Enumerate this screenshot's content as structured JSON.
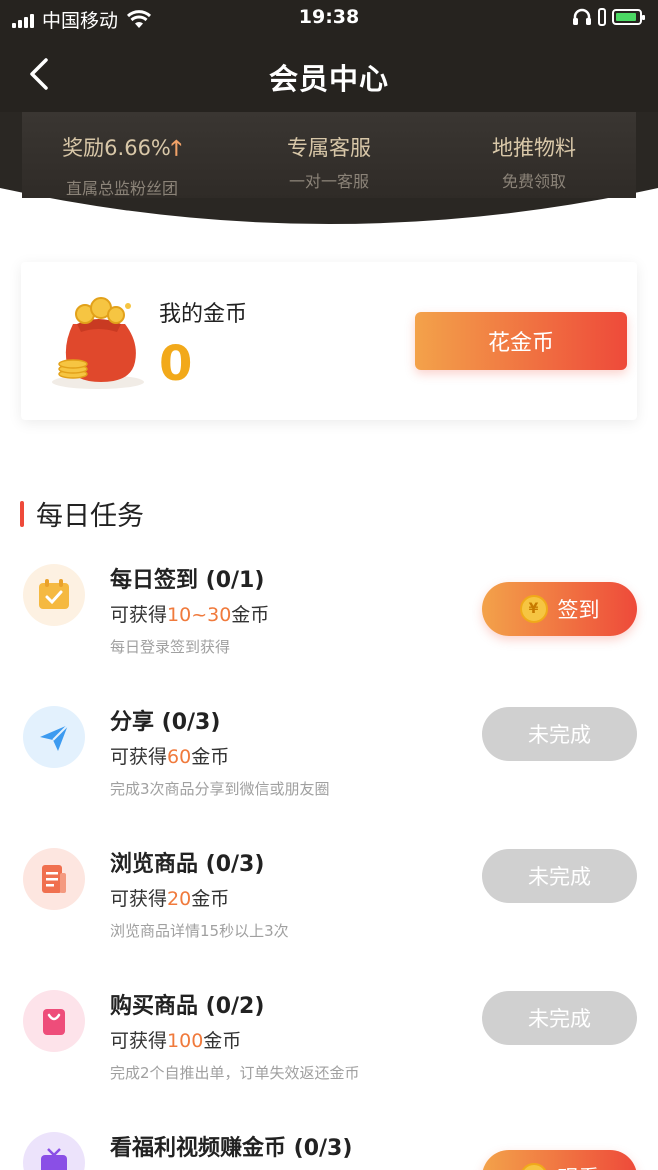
{
  "status_bar": {
    "carrier": "中国移动",
    "time": "19:38"
  },
  "nav": {
    "title": "会员中心"
  },
  "benefits": [
    {
      "title": "奖励6.66%",
      "arrow": "🡑",
      "subtitle": "直属总监粉丝团"
    },
    {
      "title": "专属客服",
      "subtitle": "一对一客服"
    },
    {
      "title": "地推物料",
      "subtitle": "免费领取"
    }
  ],
  "coins": {
    "label": "我的金币",
    "value": "0",
    "spend_button": "花金币"
  },
  "daily_tasks": {
    "title": "每日任务",
    "items": [
      {
        "name": "每日签到 (0/1)",
        "reward_prefix": "可获得",
        "reward_amount": "10~30",
        "reward_suffix": "金币",
        "desc": "每日登录签到获得",
        "button": "签到",
        "button_coin": "¥",
        "icon": "calendar-check-icon"
      },
      {
        "name": "分享 (0/3)",
        "reward_prefix": "可获得",
        "reward_amount": "60",
        "reward_suffix": "金币",
        "desc": "完成3次商品分享到微信或朋友圈",
        "button": "未完成",
        "icon": "paper-plane-icon"
      },
      {
        "name": "浏览商品 (0/3)",
        "reward_prefix": "可获得",
        "reward_amount": "20",
        "reward_suffix": "金币",
        "desc": "浏览商品详情15秒以上3次",
        "button": "未完成",
        "icon": "document-icon"
      },
      {
        "name": "购买商品 (0/2)",
        "reward_prefix": "可获得",
        "reward_amount": "100",
        "reward_suffix": "金币",
        "desc": "完成2个自推出单，订单失效返还金币",
        "button": "未完成",
        "icon": "shopping-bag-icon"
      },
      {
        "name": "看福利视频赚金币 (0/3)",
        "button": "观看",
        "button_coin": "¥",
        "icon": "tv-icon"
      }
    ]
  },
  "colors": {
    "accent_start": "#f3a24a",
    "accent_end": "#ee4a3a",
    "coin_value": "#f2a91a",
    "reward_number": "#f07a3c",
    "dark_header": "#26231f",
    "disabled_button": "#d0d0d0"
  }
}
